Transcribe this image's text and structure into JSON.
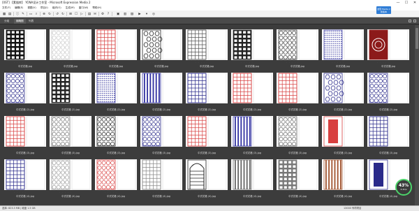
{
  "window": {
    "title": "[0ST] 【素描库】 YONA设计工作室 - Microsoft Expression Media 2",
    "minimize": "—",
    "maximize": "☐",
    "close": "✕"
  },
  "menu": [
    "文件(F)",
    "编辑(E)",
    "视图(V)",
    "项目(I)",
    "组织(O)",
    "生成(M)",
    "窗口(W)",
    "帮助(H)"
  ],
  "toolbar": {
    "update_badge": "发现 Media 2 新版本"
  },
  "tabs": [
    {
      "label": "分组"
    },
    {
      "label": "缩略图"
    },
    {
      "label": "列表"
    }
  ],
  "thumbnails": [
    {
      "name": "中式花格.jpg",
      "stars": "· · · · ·",
      "pattern": "lattice-black",
      "color": "#111111"
    },
    {
      "name": "中式花格.jpg",
      "stars": "· · · · ·",
      "pattern": "circles",
      "color": "#c8c8c8"
    },
    {
      "name": "中式花格.jpg",
      "stars": "· · · · ·",
      "pattern": "grid-red",
      "color": "#d84040"
    },
    {
      "name": "中式花格.jpg",
      "stars": "· · · · ·",
      "pattern": "hex-black",
      "color": "#222222"
    },
    {
      "name": "中式花格.jpg",
      "stars": "· · · · ·",
      "pattern": "grid-gray",
      "color": "#555555"
    },
    {
      "name": "中式花格.jpg",
      "stars": "· · · · ·",
      "pattern": "lattice-black",
      "color": "#222222"
    },
    {
      "name": "中式花格.jpg",
      "stars": "· · · · ·",
      "pattern": "circles-black",
      "color": "#333333"
    },
    {
      "name": "中式花格.jpg",
      "stars": "· · · · ·",
      "pattern": "dots-blue",
      "color": "#4a4aa8"
    },
    {
      "name": "中式花格.jpg",
      "stars": "· · · · ·",
      "pattern": "ornament-red",
      "color": "#8c1a1a"
    },
    {
      "name": "中式花格 (2).jpg",
      "stars": "· · · · ·",
      "pattern": "circles-blue",
      "color": "#2a2a8a"
    },
    {
      "name": "中式花格 (2).jpg",
      "stars": "· · · · ·",
      "pattern": "lattice-black",
      "color": "#222222"
    },
    {
      "name": "中式花格 (2).jpg",
      "stars": "· · · · ·",
      "pattern": "dots-blue",
      "color": "#3c3ca0"
    },
    {
      "name": "中式花格 (2).jpg",
      "stars": "· · · · ·",
      "pattern": "stripe-blue",
      "color": "#3030a0"
    },
    {
      "name": "中式花格 (2).jpg",
      "stars": "· · · · ·",
      "pattern": "grid-blue",
      "color": "#2a2a8a"
    },
    {
      "name": "中式花格 (2).jpg",
      "stars": "· · · · ·",
      "pattern": "grid-red",
      "color": "#d84040"
    },
    {
      "name": "中式花格 (2).jpg",
      "stars": "· · · · ·",
      "pattern": "grid-red",
      "color": "#d84040"
    },
    {
      "name": "中式花格 (2).jpg",
      "stars": "· · · · ·",
      "pattern": "hex-blue",
      "color": "#2a2a8a"
    },
    {
      "name": "中式花格 (2).jpg",
      "stars": "· · · · ·",
      "pattern": "circles-blue",
      "color": "#2a2a8a"
    },
    {
      "name": "中式花格 (3).jpg",
      "stars": "· · · · ·",
      "pattern": "grid-red",
      "color": "#d84040"
    },
    {
      "name": "中式花格 (3).jpg",
      "stars": "· · · · ·",
      "pattern": "circles-gray",
      "color": "#777777"
    },
    {
      "name": "中式花格 (3).jpg",
      "stars": "· · · · ·",
      "pattern": "circles-black",
      "color": "#222222"
    },
    {
      "name": "中式花格 (3).jpg",
      "stars": "· · · · ·",
      "pattern": "circles-blue",
      "color": "#2a2a8a"
    },
    {
      "name": "中式花格 (3).jpg",
      "stars": "· · · · ·",
      "pattern": "grid-red",
      "color": "#d84040"
    },
    {
      "name": "中式花格 (3).jpg",
      "stars": "· · · · ·",
      "pattern": "stripe-blue",
      "color": "#3030a0"
    },
    {
      "name": "中式花格 (3).jpg",
      "stars": "· · · · ·",
      "pattern": "circles-gray",
      "color": "#666666"
    },
    {
      "name": "中式花格 (3).jpg",
      "stars": "· · · · ·",
      "pattern": "block-red",
      "color": "#d84040"
    },
    {
      "name": "中式花格 (3).jpg",
      "stars": "· · · · ·",
      "pattern": "grid-blue",
      "color": "#2a2a8a"
    },
    {
      "name": "中式花格 (4).jpg",
      "stars": "· · · · ·",
      "pattern": "grid-blue",
      "color": "#2a2a8a"
    },
    {
      "name": "中式花格 (4).jpg",
      "stars": "· · · · ·",
      "pattern": "circles-gray",
      "color": "#999999"
    },
    {
      "name": "中式花格 (4).jpg",
      "stars": "· · · · ·",
      "pattern": "circles-red",
      "color": "#d84040"
    },
    {
      "name": "中式花格 (4).jpg",
      "stars": "· · · · ·",
      "pattern": "grid-gray",
      "color": "#888888"
    },
    {
      "name": "中式花格 (4).jpg",
      "stars": "· · · · ·",
      "pattern": "arch-black",
      "color": "#222222"
    },
    {
      "name": "中式花格 (4).jpg",
      "stars": "· · · · ·",
      "pattern": "stripe-gray",
      "color": "#666666"
    },
    {
      "name": "中式花格 (4).jpg",
      "stars": "· · · · ·",
      "pattern": "lattice-gray",
      "color": "#777777"
    },
    {
      "name": "中式花格 (4).jpg",
      "stars": "· · · · ·",
      "pattern": "stripe-brown",
      "color": "#a0522d"
    },
    {
      "name": "中式花格 (4).jpg",
      "stars": "· · · · ·",
      "pattern": "block-blue",
      "color": "#2a2a8a"
    }
  ],
  "status": {
    "left": "选择: 823.3 MB | 磁盘 1.5 GB",
    "right": "13000 列项项目"
  },
  "progress": {
    "percent": "43%",
    "label": "4.2k/s"
  }
}
